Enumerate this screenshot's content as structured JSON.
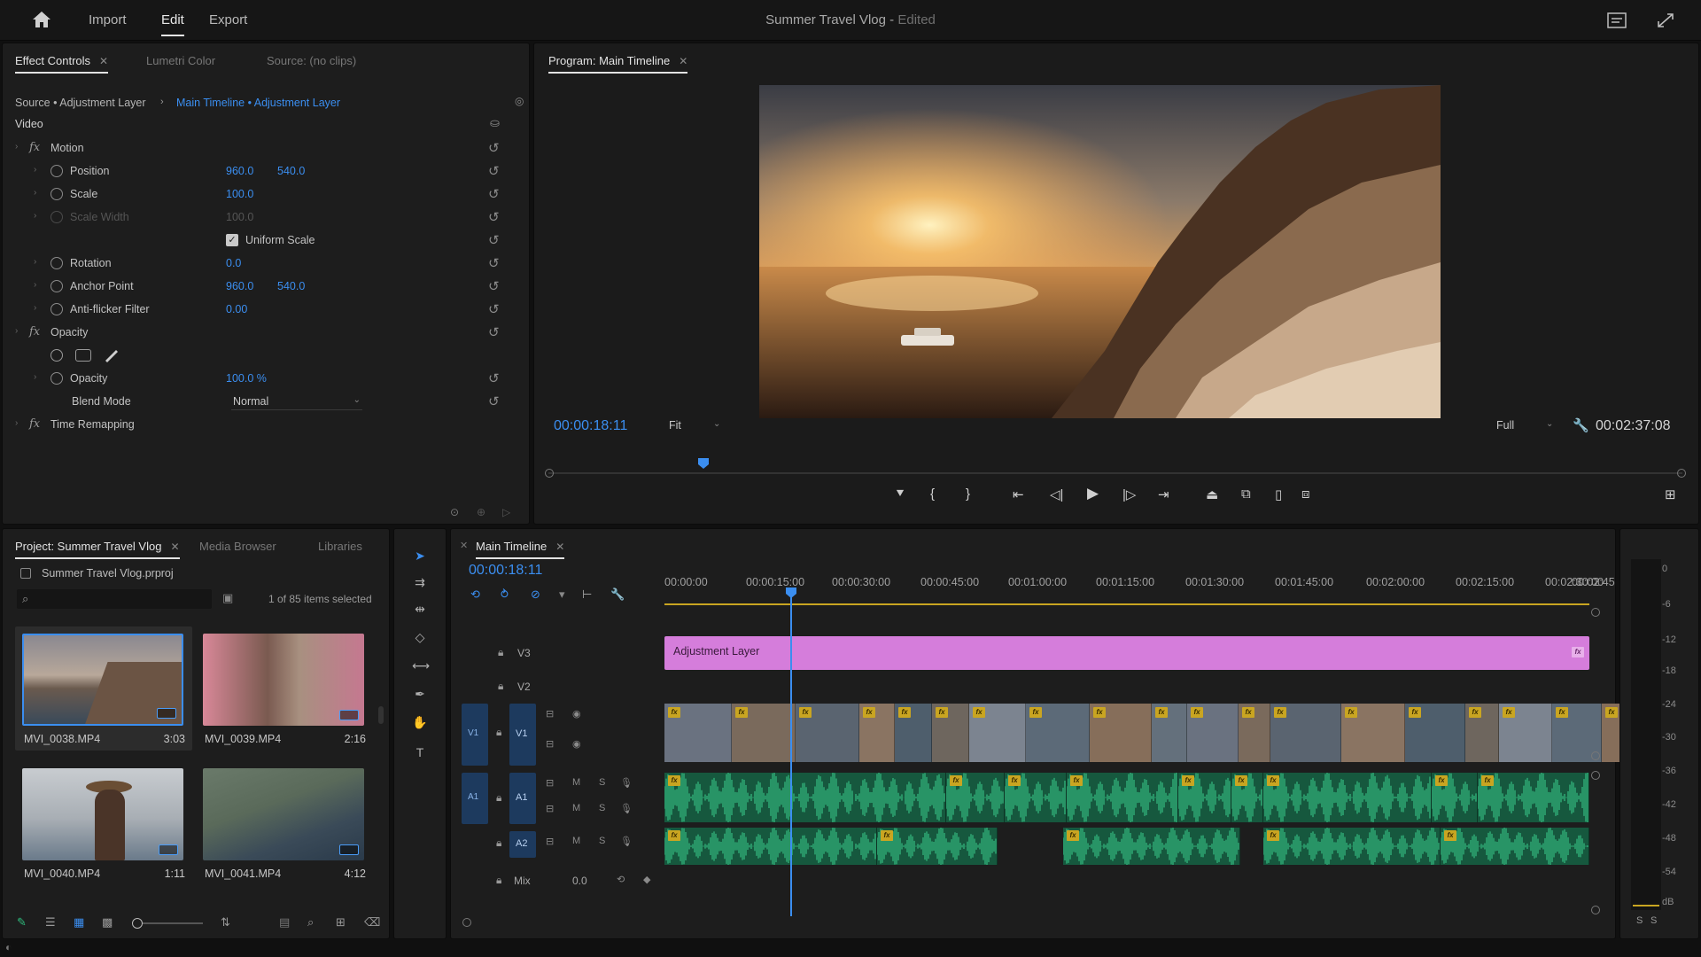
{
  "menu": {
    "home_icon": "home-icon",
    "items": [
      "Import",
      "Edit",
      "Export"
    ],
    "active": "Edit"
  },
  "title": {
    "name": "Summer Travel Vlog",
    "separator": " - ",
    "status": "Edited"
  },
  "effect_controls": {
    "tabs": [
      "Effect Controls",
      "Lumetri Color",
      "Source: (no clips)"
    ],
    "breadcrumb_source": "Source • Adjustment Layer",
    "breadcrumb_target": "Main Timeline • Adjustment Layer",
    "section_video": "Video",
    "motion_label": "Motion",
    "fx_label": "fx",
    "position_label": "Position",
    "position_x": "960.0",
    "position_y": "540.0",
    "scale_label": "Scale",
    "scale_value": "100.0",
    "scale_width_label": "Scale Width",
    "scale_width_value": "100.0",
    "uniform_scale_label": "Uniform Scale",
    "rotation_label": "Rotation",
    "rotation_value": "0.0",
    "anchor_label": "Anchor Point",
    "anchor_x": "960.0",
    "anchor_y": "540.0",
    "antiflicker_label": "Anti-flicker Filter",
    "antiflicker_value": "0.00",
    "opacity_group_label": "Opacity",
    "opacity_label": "Opacity",
    "opacity_value": "100.0 %",
    "blend_label": "Blend Mode",
    "blend_value": "Normal",
    "time_remap_label": "Time Remapping"
  },
  "program": {
    "tab": "Program: Main Timeline",
    "timecode": "00:00:18:11",
    "fit": "Fit",
    "quality": "Full",
    "duration": "00:02:37:08",
    "playhead_fraction": 0.137
  },
  "project": {
    "tabs": [
      "Project: Summer Travel Vlog",
      "Media Browser",
      "Libraries"
    ],
    "file": "Summer Travel Vlog.prproj",
    "selection": "1 of 85 items selected",
    "clips": [
      {
        "name": "MVI_0038.MP4",
        "duration": "3:03"
      },
      {
        "name": "MVI_0039.MP4",
        "duration": "2:16"
      },
      {
        "name": "MVI_0040.MP4",
        "duration": "1:11"
      },
      {
        "name": "MVI_0041.MP4",
        "duration": "4:12"
      }
    ]
  },
  "timeline": {
    "tab": "Main Timeline",
    "timecode": "00:00:18:11",
    "ruler": [
      "00:00:00",
      "00:00:15:00",
      "00:00:30:00",
      "00:00:45:00",
      "00:01:00:00",
      "00:01:15:00",
      "00:01:30:00",
      "00:01:45:00",
      "00:02:00:00",
      "00:02:15:00",
      "00:02:30:00",
      "00:02:45"
    ],
    "tracks": {
      "v3": "V3",
      "v2": "V2",
      "v1": "V1",
      "a1": "A1",
      "a2": "A2",
      "mix": "Mix",
      "mix_value": "0.0",
      "src_v1": "V1",
      "src_a1": "A1"
    },
    "track_btns": {
      "m": "M",
      "s": "S"
    },
    "adjustment_clip": "Adjustment Layer",
    "fx_badge": "fx"
  },
  "meter": {
    "labels": [
      "0",
      "-6",
      "-12",
      "-18",
      "-24",
      "-30",
      "-36",
      "-42",
      "-48",
      "-54",
      "dB"
    ],
    "bottom": [
      "S",
      "S"
    ]
  },
  "colors": {
    "accent": "#3b8ef0",
    "adjustment": "#d57ddb",
    "audio": "#2fbf7f",
    "fx": "#c9a521"
  }
}
